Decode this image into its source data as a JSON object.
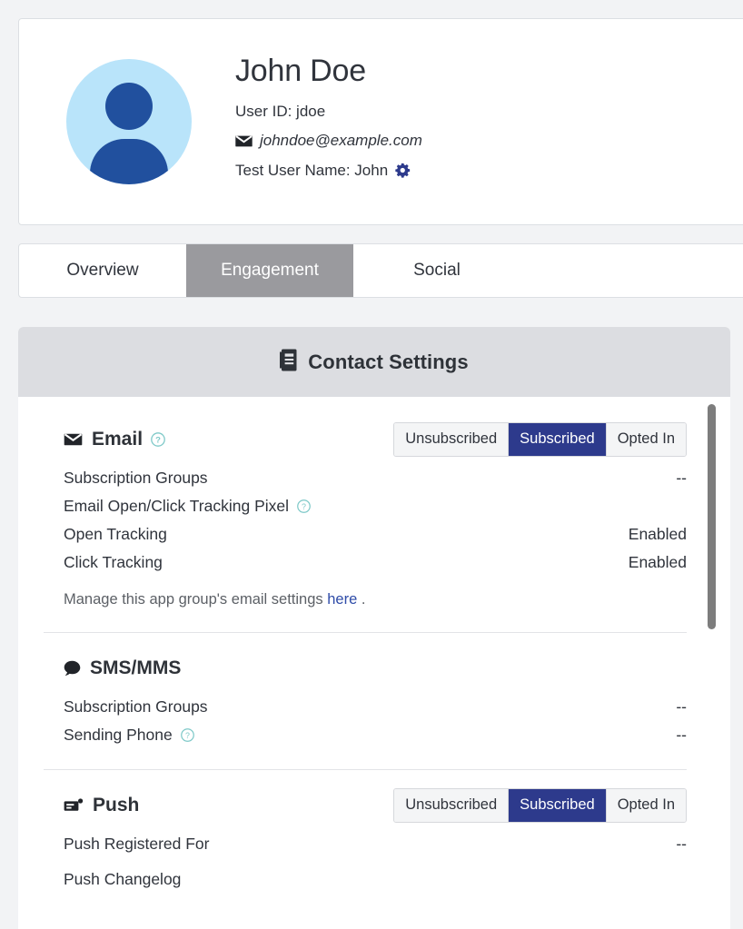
{
  "profile": {
    "name": "John Doe",
    "user_id_line": "User ID: jdoe",
    "email": "johndoe@example.com",
    "test_user_line": "Test User Name: John",
    "avatar_icon": "user-avatar-icon",
    "mail_icon": "envelope-icon",
    "gear_icon": "gear-icon",
    "avatar_bg": "#b9e4fa",
    "avatar_fg": "#21509e",
    "gear_color": "#2d3a8c"
  },
  "tabs": [
    {
      "label": "Overview",
      "active": false
    },
    {
      "label": "Engagement",
      "active": true
    },
    {
      "label": "Social",
      "active": false
    }
  ],
  "contact_settings": {
    "header_title": "Contact Settings",
    "header_icon": "address-book-icon",
    "header_bg": "#dcdde1",
    "accent_selected": "#2d3a8c",
    "help_icon_color": "#7ec9c8",
    "email": {
      "title": "Email",
      "icon": "envelope-icon",
      "help_icon": "help-circle-icon",
      "segments": [
        {
          "label": "Unsubscribed",
          "selected": false
        },
        {
          "label": "Subscribed",
          "selected": true
        },
        {
          "label": "Opted In",
          "selected": false
        }
      ],
      "rows": [
        {
          "label": "Subscription Groups",
          "value": "--",
          "help": false
        },
        {
          "label": "Email Open/Click Tracking Pixel",
          "value": "",
          "help": true
        },
        {
          "label": "Open Tracking",
          "value": "Enabled",
          "help": false
        },
        {
          "label": "Click Tracking",
          "value": "Enabled",
          "help": false
        }
      ],
      "note_prefix": "Manage this app group's email settings ",
      "note_link": "here",
      "note_suffix": " ."
    },
    "sms": {
      "title": "SMS/MMS",
      "icon": "speech-bubble-icon",
      "rows": [
        {
          "label": "Subscription Groups",
          "value": "--",
          "help": false
        },
        {
          "label": "Sending Phone",
          "value": "--",
          "help": true
        }
      ]
    },
    "push": {
      "title": "Push",
      "icon": "push-notification-icon",
      "segments": [
        {
          "label": "Unsubscribed",
          "selected": false
        },
        {
          "label": "Subscribed",
          "selected": true
        },
        {
          "label": "Opted In",
          "selected": false
        }
      ],
      "rows": [
        {
          "label": "Push Registered For",
          "value": "--",
          "help": false
        },
        {
          "label": "Push Changelog",
          "value": "",
          "help": false
        }
      ]
    },
    "scrollbar": {
      "name": "vertical-scrollbar"
    }
  }
}
